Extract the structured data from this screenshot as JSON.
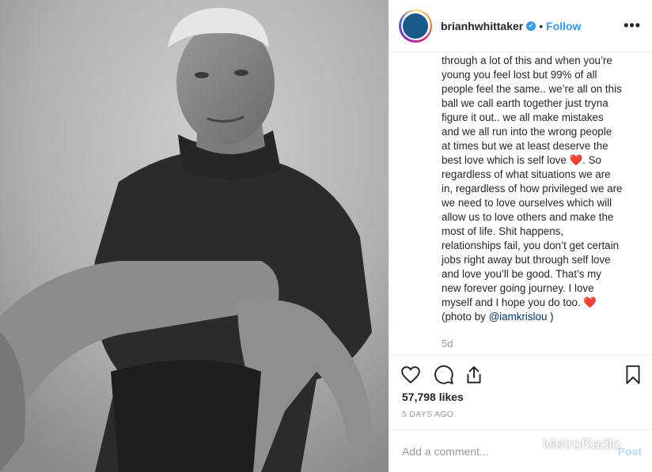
{
  "post": {
    "username": "brianhwhittaker",
    "verified_glyph": "✓",
    "separator": "•",
    "follow_label": "Follow",
    "more_label": "•••",
    "caption_lines": [
      "through a lot of this and when you’re",
      "young you feel lost but 99% of all",
      "people feel the same.. we’re all on this",
      "ball we call earth together just tryna",
      "figure it out.. we all make mistakes",
      "and we all run into the wrong people",
      "at times but we at least deserve the",
      "best love which is self love ❤️. So",
      "regardless of what situations we are",
      "in, regardless of how privileged we are",
      "we need to love ourselves which will",
      "allow us to love others and make the",
      "most of life. Shit happens,",
      "relationships fail, you don’t get certain",
      "jobs right away but through self love",
      "and love you’ll be good. That’s my",
      "new forever going journey. I love",
      "myself and I hope you do too. ❤️"
    ],
    "photo_credit_prefix": "(photo by ",
    "photo_credit_mention": "@iamkrislou",
    "photo_credit_suffix": " )",
    "time_ago": "5d",
    "likes": "57,798 likes",
    "post_date": "5 DAYS AGO",
    "comment_placeholder": "Add a comment...",
    "post_label": "Post"
  },
  "watermark": {
    "text": "MetroRadio"
  },
  "icons": {
    "like": "heart-icon",
    "comment": "comment-icon",
    "share": "share-icon",
    "save": "bookmark-icon"
  },
  "colors": {
    "accent": "#3897f0",
    "text": "#262626",
    "muted": "#999999",
    "border": "#efefef",
    "mention": "#003569",
    "heart": "#e0245e"
  }
}
